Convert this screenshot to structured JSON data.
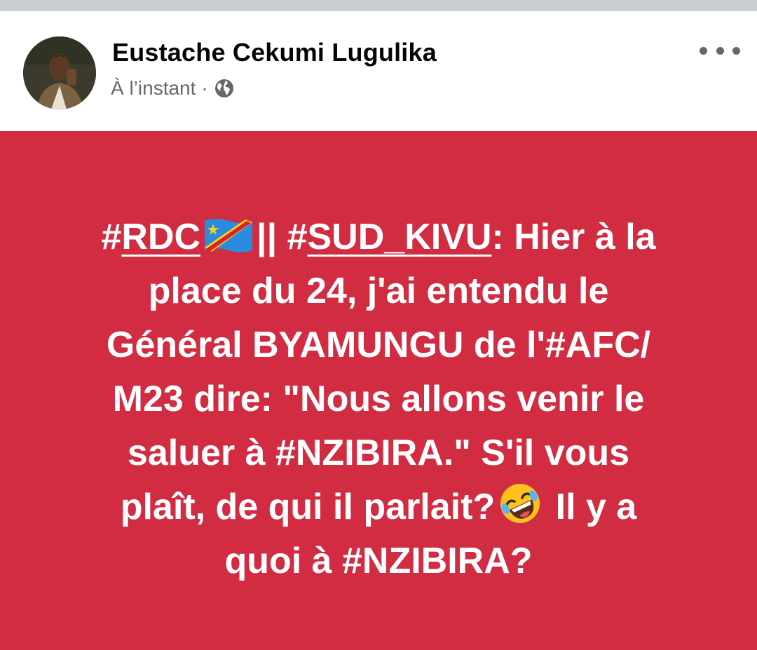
{
  "post": {
    "author": "Eustache Cekumi Lugulika",
    "time": "À l’instant",
    "separator": "·",
    "privacy_icon": "globe-icon",
    "more_icon": "more-options-icon",
    "background_color": "#d12c42",
    "text": {
      "line1": {
        "hash1": "#",
        "tag1": "RDC",
        "flag": "drc-flag-emoji",
        "mid": "|| #",
        "tag2": "SUD_KIVU",
        "rest": ": Hier à la"
      },
      "line2": "place du 24, j'ai entendu le",
      "line3": {
        "pre": "Général BYAMUNGU de l'#",
        "tag": "AFC",
        "post": "/"
      },
      "line4": "M23 dire: \"Nous allons venir le",
      "line5": {
        "pre": "saluer à #",
        "tag": "NZIBIRA",
        "post": ".\" S'il vous"
      },
      "line6": {
        "pre": "plaît, de qui il parlait?",
        "emoji": "rolling-on-the-floor-laughing-emoji",
        "post": " Il y a"
      },
      "line7": {
        "pre": "quoi à #",
        "tag": "NZIBIRA",
        "post": "?"
      }
    }
  }
}
